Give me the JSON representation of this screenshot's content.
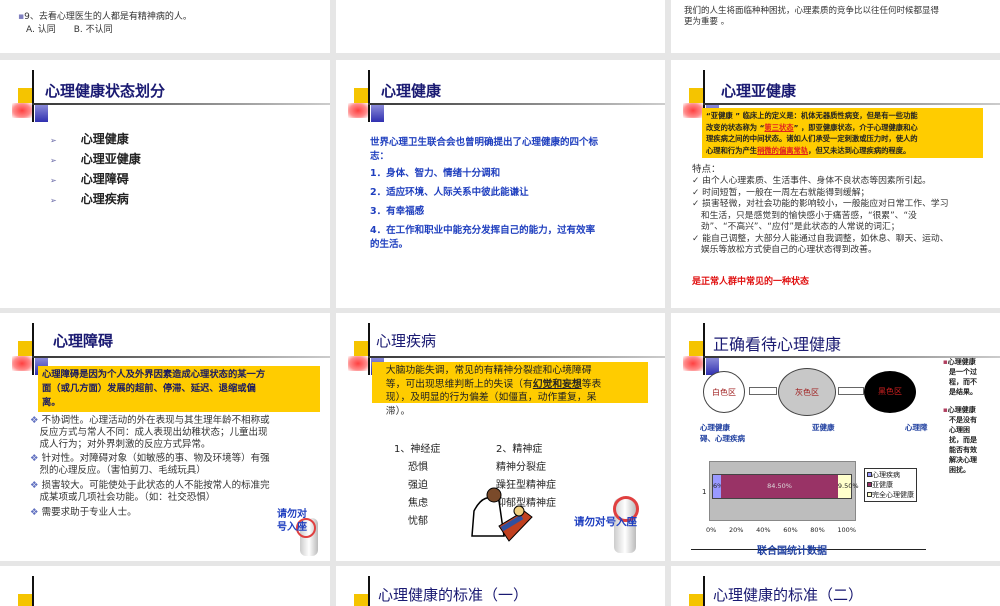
{
  "slides": {
    "s_prev1": {
      "question": "9、去看心理医生的人都是有精神病的人。",
      "opt_a": "A. 认同",
      "opt_b": "B. 不认同"
    },
    "s_prev3": {
      "line1": "我们的人生将面临种种困扰，心理素质的竞争比以往任何时候都显得",
      "line2": "更为重要 。"
    },
    "s1": {
      "title": "心理健康状态划分",
      "items": [
        "心理健康",
        "心理亚健康",
        "心理障碍",
        "心理疾病"
      ]
    },
    "s2": {
      "title": "心理健康",
      "intro1": "世界心理卫生联合会也曾明确提出了心理健康的四个标",
      "intro2": "志：",
      "items": [
        "1．身体、智力、情绪十分调和",
        "2．适应环境、人际关系中彼此能谦让",
        "3．有幸福感",
        "4．在工作和职业中能充分发挥自己的能力，过有效率"
      ],
      "item4b": "的生活。"
    },
    "s3": {
      "title": "心理亚健康",
      "box1": "“亚健康 ” 临床上的定义是：机体无器质性病变，但是有一些功能",
      "box2a": "改变的状态称为 “",
      "box2red": "第三状态",
      "box2b": "” ，即亚健康状态，介于心理健康和心",
      "box3": "理疾病之间的中间状态。诸如人们承受一定刺激或压力时，使人的",
      "box4a": "心理和行为产生",
      "box4red": "稍微的偏离常轨",
      "box4b": "，但又未达到心理疾病的程度。",
      "feat": "特点：",
      "bullets": [
        [
          "由个人心理素质、生活事件、身体不良状态等因素所引起。"
        ],
        [
          "时间短暂，一般在一周左右就能得到缓解；"
        ],
        [
          "损害轻微，对社会功能的影响较小，一般能应对日常工作、学习",
          "和生活，只是感觉到的愉快感小于痛苦感，“很累”、“没",
          "劲”、“不高兴”、“应付”是此状态的人常说的词汇；"
        ],
        [
          "能自己调整，大部分人能通过自我调整，如休息、聊天、运动、",
          "娱乐等放松方式使自己的心理状态得到改善。"
        ]
      ],
      "conclusion": "是正常人群中常见的一种状态"
    },
    "s4": {
      "title": "心理障碍",
      "box": [
        "心理障碍是因为个人及外界因素造成心理状态的某一方",
        "面（或几方面）发展的超前、停滞、延迟、退缩或偏",
        "离。"
      ],
      "bullets": [
        [
          "不协调性。心理活动的外在表现与其生理年龄不相称或",
          "反应方式与常人不同：成人表现出幼稚状态；儿童出现",
          "成人行为；对外界刺激的反应方式异常。"
        ],
        [
          "针对性。对障碍对象（如敏感的事、物及环境等）有强",
          "烈的心理反应。（害怕剪刀、毛绒玩具）"
        ],
        [
          "损害较大。可能使处于此状态的人不能按常人的标准完",
          "成某项或几项社会功能。（如：社交恐惧）"
        ],
        [
          "需要求助于专业人士。"
        ]
      ],
      "warn1": "请勿对",
      "warn2": "号入座"
    },
    "s5": {
      "title": "心理疾病",
      "box1": "　大脑功能失调，常见的有精神分裂症和心境障碍",
      "box2a": "等，可出现思维判断上的失误（有",
      "box2u": "幻觉和妄想",
      "box2b": "等表",
      "box3": "现），及明显的行为偏差（如僵直，动作重复，呆",
      "box4": "滞）。",
      "col1": [
        "1、神经症",
        "恐惧",
        "强迫",
        "焦虑",
        "忧郁"
      ],
      "col2": [
        "2、精神症",
        "精神分裂症",
        "躁狂型精神症",
        "抑郁型精神症"
      ],
      "warn": "请勿对号入座"
    },
    "s6": {
      "title": "正确看待心理健康",
      "zones": [
        "白色区",
        "灰色区",
        "黑色区"
      ],
      "lbl_left": "心理健康",
      "lbl_mid": "亚健康",
      "lbl_right": "心理障",
      "lbl_left2": "碍、心理疾病",
      "side1": [
        "心理健康",
        "是一个过",
        "程，而不",
        "是结果。"
      ],
      "side2": [
        "心理健康",
        "不是没有",
        "心理困",
        "扰，而是",
        "能否有效",
        "解决心理",
        "困扰。"
      ],
      "caption": "联合国统计数据"
    },
    "s7": {
      "title": "心理健康的标准（一）"
    },
    "s8": {
      "title": "心理健康的标准（二）"
    }
  },
  "chart_data": {
    "type": "bar",
    "stacked": true,
    "orientation": "horizontal",
    "categories": [
      "1"
    ],
    "series": [
      {
        "name": "心理疾病",
        "values": [
          6
        ],
        "label": "6%",
        "color": "#9999ff"
      },
      {
        "name": "亚健康",
        "values": [
          84.5
        ],
        "label": "84.50%",
        "color": "#993366"
      },
      {
        "name": "完全心理健康",
        "values": [
          9.5
        ],
        "label": "9.50%",
        "color": "#ffffcc"
      }
    ],
    "xticks": [
      "0%",
      "20%",
      "40%",
      "60%",
      "80%",
      "100%"
    ],
    "xlim": [
      0,
      100
    ],
    "legend": "right",
    "title": "联合国统计数据"
  }
}
